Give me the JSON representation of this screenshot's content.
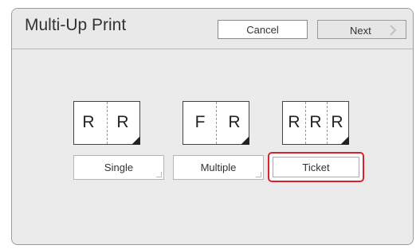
{
  "screen": {
    "title": "Multi-Up Print"
  },
  "header": {
    "cancel_label": "Cancel",
    "next_label": "Next"
  },
  "options": [
    {
      "label": "Single",
      "icon_letters": [
        "R",
        "R"
      ],
      "selected": false
    },
    {
      "label": "Multiple",
      "icon_letters": [
        "F",
        "R"
      ],
      "selected": false
    },
    {
      "label": "Ticket",
      "icon_letters": [
        "R",
        "R",
        "R"
      ],
      "selected": true
    }
  ],
  "colors": {
    "selection_highlight": "#d8232a",
    "panel_background": "#ebebeb"
  },
  "icons": {
    "next_chevron": "chevron-right-icon"
  }
}
